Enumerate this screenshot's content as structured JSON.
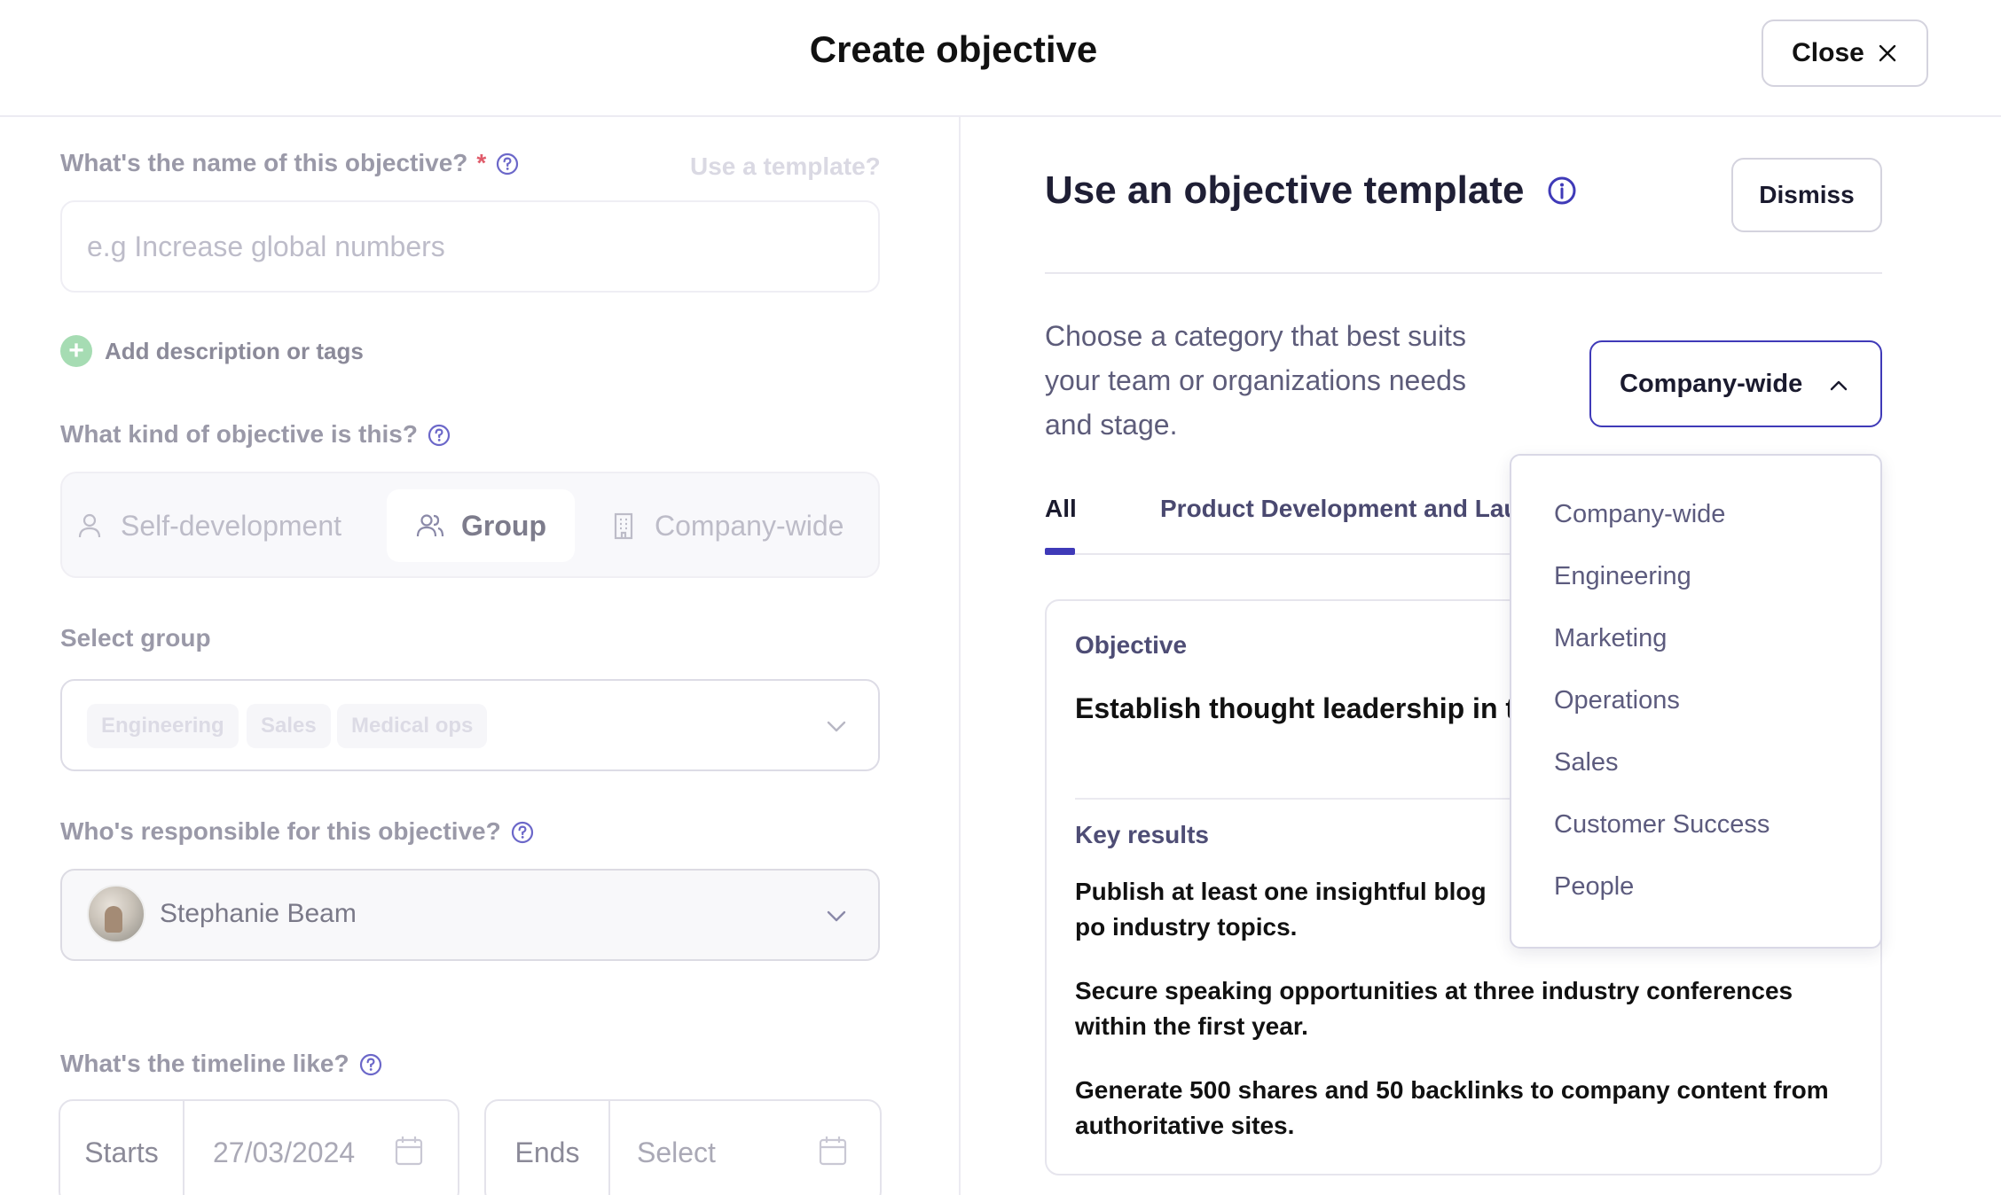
{
  "header": {
    "title": "Create objective",
    "close_label": "Close"
  },
  "form": {
    "name_label": "What's the name of this objective?",
    "required_mark": "*",
    "use_template_link": "Use a template?",
    "name_placeholder": "e.g Increase global numbers",
    "add_description": "Add description or tags",
    "kind_label": "What kind of objective is this?",
    "kind_options": [
      "Self-development",
      "Group",
      "Company-wide"
    ],
    "kind_selected": "Group",
    "select_group_label": "Select group",
    "group_chips": [
      "Engineering",
      "Sales",
      "Medical ops"
    ],
    "responsible_label": "Who's responsible for this objective?",
    "responsible_name": "Stephanie Beam",
    "timeline_label": "What's the timeline like?",
    "starts_label": "Starts",
    "starts_value": "27/03/2024",
    "ends_label": "Ends",
    "ends_placeholder": "Select"
  },
  "template_panel": {
    "title": "Use an objective template",
    "dismiss_label": "Dismiss",
    "choose_text": "Choose a category that best suits your team or organizations needs and stage.",
    "category_selected": "Company-wide",
    "tabs": [
      "All",
      "Product Development and Lau"
    ],
    "active_tab": "All",
    "card": {
      "objective_label": "Objective",
      "objective_text": "Establish thought leadership in t industry.",
      "key_results_label": "Key results",
      "key_results": [
        "Publish at least one insightful blog po industry topics.",
        "Secure speaking opportunities at three industry conferences within the first year.",
        "Generate 500 shares and 50 backlinks to company content from authoritative sites."
      ]
    }
  },
  "category_dropdown": {
    "options": [
      "Company-wide",
      "Engineering",
      "Marketing",
      "Operations",
      "Sales",
      "Customer Success",
      "People"
    ]
  },
  "colors": {
    "accent": "#3f3ab8",
    "required": "#e05b6a",
    "add_icon_bg": "#a6dcb3"
  },
  "icons": [
    "close-icon",
    "help-icon",
    "plus-icon",
    "user-icon",
    "users-icon",
    "building-icon",
    "chevron-down-icon",
    "chevron-up-icon",
    "calendar-icon",
    "info-icon"
  ]
}
